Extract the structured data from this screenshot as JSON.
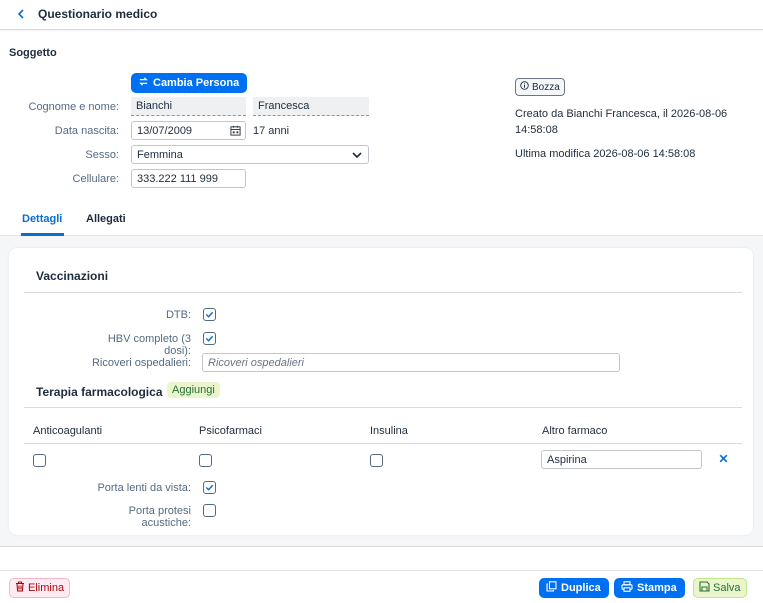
{
  "header": {
    "title": "Questionario medico"
  },
  "subject": {
    "section_label": "Soggetto",
    "change_person_label": "Cambia Persona",
    "name_label": "Cognome e nome:",
    "surname": "Bianchi",
    "firstname": "Francesca",
    "birth_label": "Data nascita:",
    "birth_date": "13/07/2009",
    "age": "17 anni",
    "sex_label": "Sesso:",
    "sex_value": "Femmina",
    "phone_label": "Cellulare:",
    "phone_value": "333.222 111 999"
  },
  "status": {
    "badge": "Bozza",
    "created_line1": "Creato da Bianchi Francesca, il 2026-08-06",
    "created_line2": "14:58:08",
    "modified": "Ultima modifica 2026-08-06 14:58:08"
  },
  "tabs": [
    {
      "label": "Dettagli",
      "active": true
    },
    {
      "label": "Allegati",
      "active": false
    }
  ],
  "vaccinations": {
    "title": "Vaccinazioni",
    "dtb_label": "DTB:",
    "dtb_checked": true,
    "hbv_label": "HBV completo (3 dosi):",
    "hbv_checked": true,
    "hospital_label": "Ricoveri ospedalieri:",
    "hospital_placeholder": "Ricoveri ospedalieri"
  },
  "therapy": {
    "title": "Terapia farmacologica",
    "add_label": "Aggiungi",
    "columns": [
      "Anticoagulanti",
      "Psicofarmaci",
      "Insulina",
      "Altro farmaco"
    ],
    "row": {
      "anticoagulanti": false,
      "psicofarmaci": false,
      "insulina": false,
      "altro": "Aspirina"
    },
    "lenses_label": "Porta lenti da vista:",
    "lenses_checked": true,
    "hearing_label": "Porta protesi acustiche:",
    "hearing_checked": false
  },
  "footer": {
    "delete_label": "Elimina",
    "duplicate_label": "Duplica",
    "print_label": "Stampa",
    "save_label": "Salva"
  },
  "colors": {
    "accent": "#0070f2",
    "danger": "#aa0808",
    "positive": "#256f3a"
  }
}
